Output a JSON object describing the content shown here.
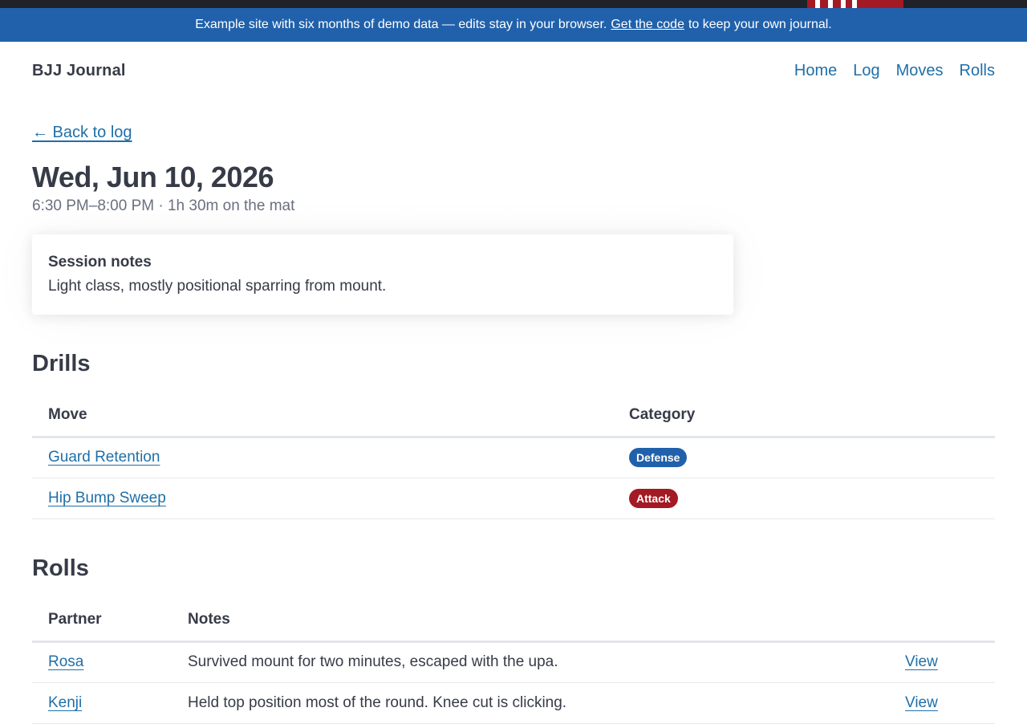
{
  "banner": {
    "text_before": "Example site with six months of demo data — edits stay in your browser.",
    "link": "Get the code",
    "text_after": "to keep your own journal."
  },
  "header": {
    "brand": "BJJ Journal",
    "nav": [
      "Home",
      "Log",
      "Moves",
      "Rolls"
    ]
  },
  "back_link": "← Back to log",
  "session": {
    "title": "Wed, Jun 10, 2026",
    "subtitle": "6:30 PM–8:00 PM · 1h 30m on the mat",
    "notes_title": "Session notes",
    "notes_body": "Light class, mostly positional sparring from mount."
  },
  "drills": {
    "heading": "Drills",
    "columns": [
      "Move",
      "Category"
    ],
    "rows": [
      {
        "move": "Guard Retention",
        "category": "Defense",
        "color": "#2161ab"
      },
      {
        "move": "Hip Bump Sweep",
        "category": "Attack",
        "color": "#a31a24"
      }
    ]
  },
  "rolls": {
    "heading": "Rolls",
    "columns": [
      "Partner",
      "Notes"
    ],
    "rows": [
      {
        "partner": "Rosa",
        "notes": "Survived mount for two minutes, escaped with the upa.",
        "action": "View"
      },
      {
        "partner": "Kenji",
        "notes": "Held top position most of the round. Knee cut is clicking.",
        "action": "View"
      }
    ]
  }
}
